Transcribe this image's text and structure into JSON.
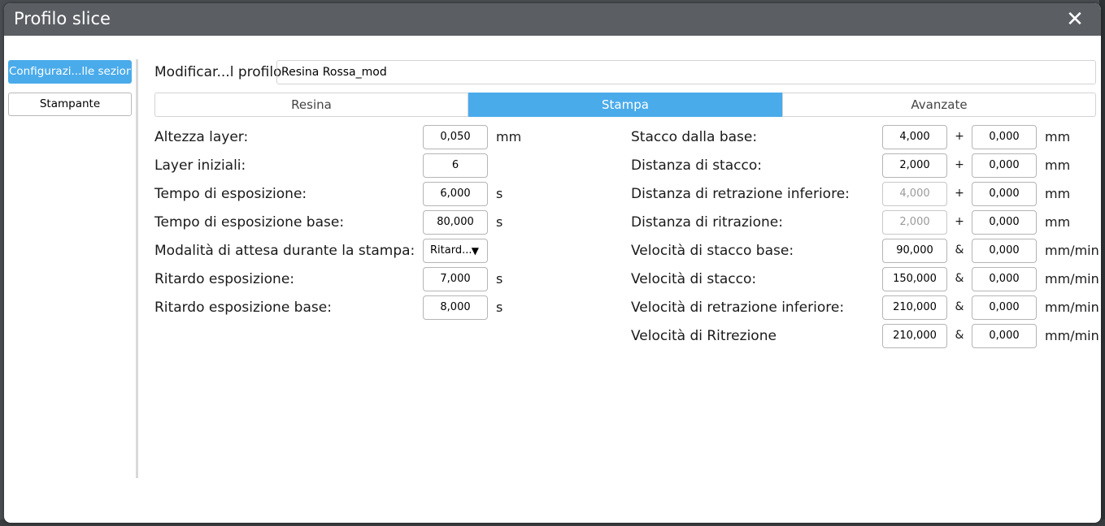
{
  "dialog": {
    "title": "Profilo slice",
    "close_icon": "close-icon"
  },
  "sidebar": {
    "items": [
      {
        "label": "Configurazi...lle sezioni",
        "active": true
      },
      {
        "label": "Stampante",
        "active": false
      }
    ]
  },
  "profile": {
    "label": "Modificar...l profilo",
    "value": "Resina Rossa_mod"
  },
  "tabs": [
    {
      "label": "Resina",
      "active": false
    },
    {
      "label": "Stampa",
      "active": true
    },
    {
      "label": "Avanzate",
      "active": false
    }
  ],
  "left_params": [
    {
      "label": "Altezza layer:",
      "value": "0,050",
      "unit": "mm"
    },
    {
      "label": "Layer iniziali:",
      "value": "6",
      "unit": ""
    },
    {
      "label": "Tempo di esposizione:",
      "value": "6,000",
      "unit": "s"
    },
    {
      "label": "Tempo di esposizione base:",
      "value": "80,000",
      "unit": "s"
    },
    {
      "label": "Modalità di attesa durante la stampa:",
      "value": "Ritard...",
      "unit": "",
      "dropdown": true
    },
    {
      "label": "Ritardo esposizione:",
      "value": "7,000",
      "unit": "s"
    },
    {
      "label": "Ritardo esposizione base:",
      "value": "8,000",
      "unit": "s"
    }
  ],
  "right_params": [
    {
      "label": "Stacco dalla base:",
      "value1": "4,000",
      "sep": "+",
      "value2": "0,000",
      "unit": "mm",
      "dim": false
    },
    {
      "label": "Distanza di stacco:",
      "value1": "2,000",
      "sep": "+",
      "value2": "0,000",
      "unit": "mm",
      "dim": false
    },
    {
      "label": "Distanza di retrazione inferiore:",
      "value1": "4,000",
      "sep": "+",
      "value2": "0,000",
      "unit": "mm",
      "dim": true
    },
    {
      "label": "Distanza di ritrazione:",
      "value1": "2,000",
      "sep": "+",
      "value2": "0,000",
      "unit": "mm",
      "dim": true
    },
    {
      "label": "Velocità di stacco base:",
      "value1": "90,000",
      "sep": "&",
      "value2": "0,000",
      "unit": "mm/min",
      "dim": false
    },
    {
      "label": "Velocità di stacco:",
      "value1": "150,000",
      "sep": "&",
      "value2": "0,000",
      "unit": "mm/min",
      "dim": false
    },
    {
      "label": "Velocità di retrazione inferiore:",
      "value1": "210,000",
      "sep": "&",
      "value2": "0,000",
      "unit": "mm/min",
      "dim": false
    },
    {
      "label": "Velocità di Ritrezione",
      "value1": "210,000",
      "sep": "&",
      "value2": "0,000",
      "unit": "mm/min",
      "dim": false
    }
  ],
  "colors": {
    "accent": "#4aabeb",
    "titlebar": "#5b5f63"
  }
}
